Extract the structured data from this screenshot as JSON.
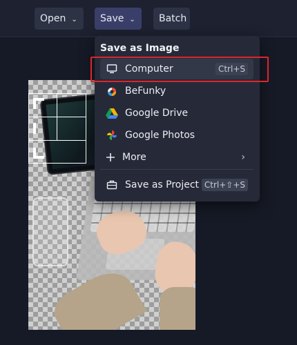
{
  "topbar": {
    "open_label": "Open",
    "save_label": "Save",
    "batch_label": "Batch"
  },
  "menu": {
    "title": "Save as Image",
    "items": [
      {
        "label": "Computer",
        "shortcut": "Ctrl+S",
        "icon": "monitor-icon"
      },
      {
        "label": "BeFunky",
        "icon": "befunky-icon"
      },
      {
        "label": "Google Drive",
        "icon": "google-drive-icon"
      },
      {
        "label": "Google Photos",
        "icon": "google-photos-icon"
      },
      {
        "label": "More",
        "icon": "plus-icon"
      },
      {
        "label": "Save as Project",
        "shortcut": "Ctrl+⇧+S",
        "icon": "briefcase-icon"
      }
    ]
  },
  "colors": {
    "highlight_border": "#e0242b",
    "menu_bg": "#262a38",
    "topbar_bg": "#1d2130"
  }
}
